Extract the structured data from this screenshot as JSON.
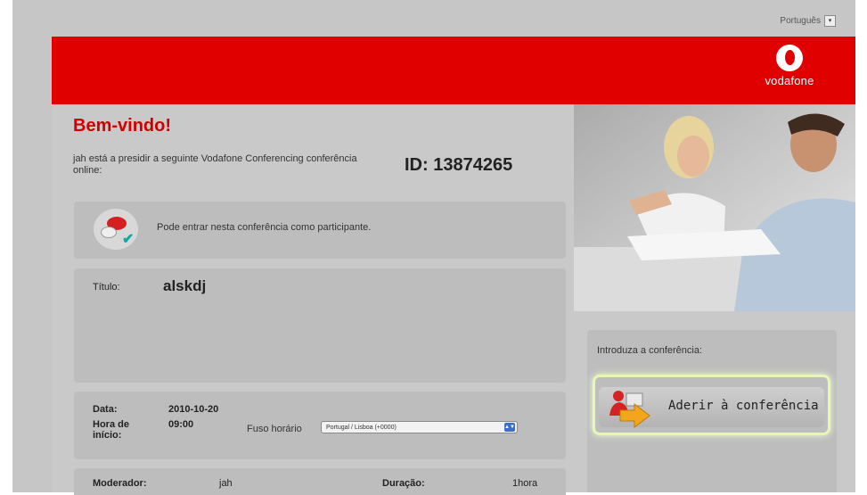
{
  "header": {
    "language": "Português",
    "language_button": "▾",
    "brand": "vodafone"
  },
  "main": {
    "welcome": "Bem-vindo!",
    "intro": "jah está a presidir a seguinte Vodafone Conferencing conferência online:",
    "conference_id": "ID: 13874265",
    "participant_notice": "Pode entrar nesta conferência como participante.",
    "title_label": "Título:",
    "title_value": "alskdj",
    "date_label": "Data:",
    "date_value": "2010-10-20",
    "start_label": "Hora de início:",
    "start_value": "09:00",
    "timezone_label": "Fuso horário",
    "timezone_value": "Portugal / Lisboa (+0000)",
    "moderator_label": "Moderador:",
    "moderator_value": "jah",
    "duration_label": "Duração:",
    "duration_value": "1hora"
  },
  "side": {
    "enter_label": "Introduza a conferência:",
    "join_button": "Aderir à conferência"
  },
  "colors": {
    "brand_red": "#e00000",
    "title_red": "#d00000",
    "panel_grey": "#bdbdbd"
  },
  "icons": [
    "chat-bubbles-icon",
    "checkmark-icon",
    "join-arrow-icon",
    "dropdown-arrow-icon"
  ]
}
